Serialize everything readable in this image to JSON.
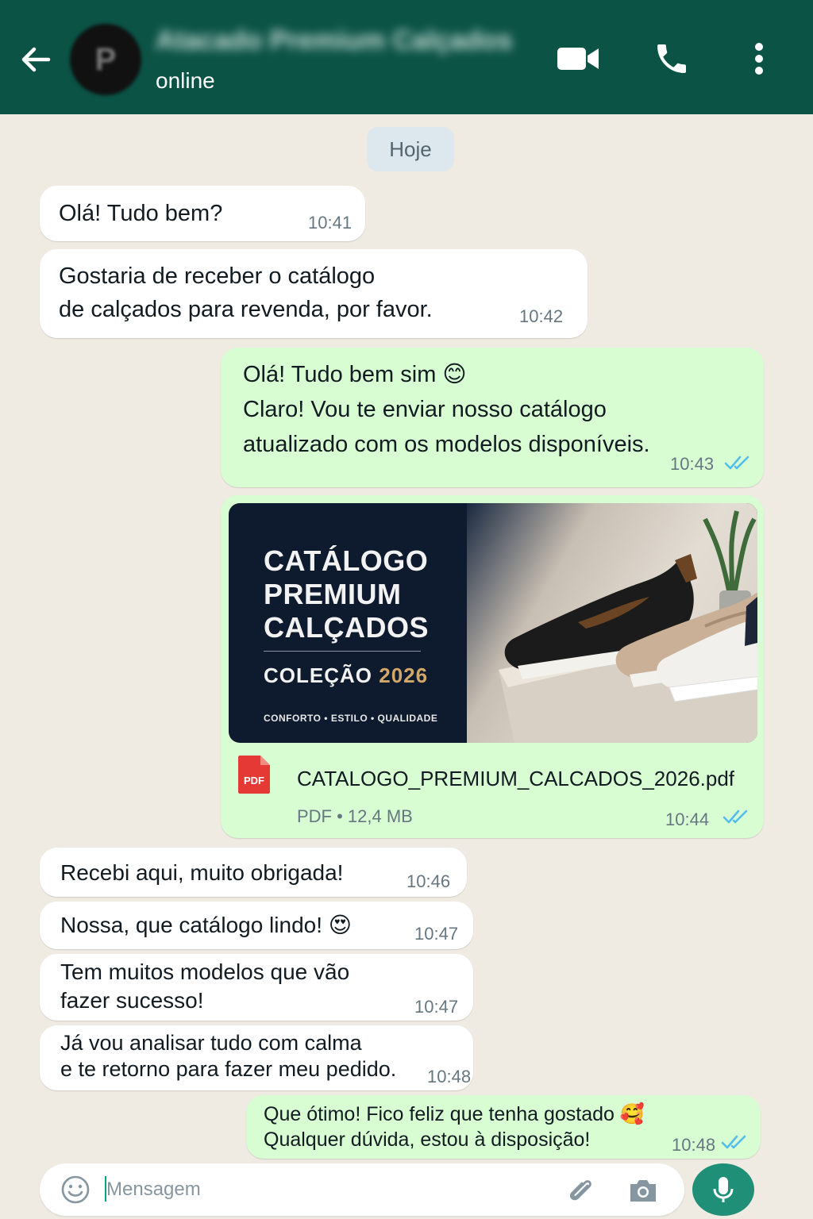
{
  "header": {
    "contact_name": "Atacado Premium Calçados",
    "avatar_letter": "P",
    "status": "online",
    "back_icon": "arrow-left-icon",
    "video_icon": "video-camera-icon",
    "call_icon": "phone-icon",
    "menu_icon": "more-vertical-icon"
  },
  "date_label": "Hoje",
  "messages": [
    {
      "dir": "in",
      "text": "Olá! Tudo bem?",
      "time": "10:41"
    },
    {
      "dir": "in",
      "text": "Gostaria de receber o catálogo\nde calçados para revenda, por favor.",
      "time": "10:42"
    },
    {
      "dir": "out",
      "text": "Olá! Tudo bem sim 😊\nClaro! Vou te enviar nosso catálogo\natualizado com os modelos disponíveis.",
      "time": "10:43",
      "status": "read"
    },
    {
      "dir": "out",
      "type": "document",
      "time": "10:44",
      "status": "read"
    },
    {
      "dir": "in",
      "text": "Recebi aqui, muito obrigada!",
      "time": "10:46"
    },
    {
      "dir": "in",
      "text": "Nossa, que catálogo lindo! 😍",
      "time": "10:47"
    },
    {
      "dir": "in",
      "text": "Tem muitos modelos que vão\nfazer sucesso!",
      "time": "10:47"
    },
    {
      "dir": "in",
      "text": "Já vou analisar tudo com calma\ne te retorno para fazer meu pedido.",
      "time": "10:48"
    },
    {
      "dir": "out",
      "text": "Que ótimo! Fico feliz que tenha gostado 🥰\nQualquer dúvida, estou à disposição!",
      "time": "10:48",
      "status": "read"
    }
  ],
  "catalog": {
    "title": "CATÁLOGO\nPREMIUM\nCALÇADOS",
    "collection_label": "COLEÇÃO",
    "collection_year": "2026",
    "tagline": "CONFORTO • ESTILO • QUALIDADE",
    "file_badge": "PDF",
    "file_name": "CATALOGO_PREMIUM_CALCADOS_2026.pdf",
    "file_meta": "PDF • 12,4 MB"
  },
  "input": {
    "placeholder": "Mensagem"
  },
  "colors": {
    "header_bg": "#0b5345",
    "chat_bg": "#efeae2",
    "outgoing_bubble": "#d9fdd3",
    "incoming_bubble": "#ffffff",
    "read_ticks": "#53bdeb",
    "mic_button": "#1f8f78",
    "pdf_red": "#e53935"
  }
}
